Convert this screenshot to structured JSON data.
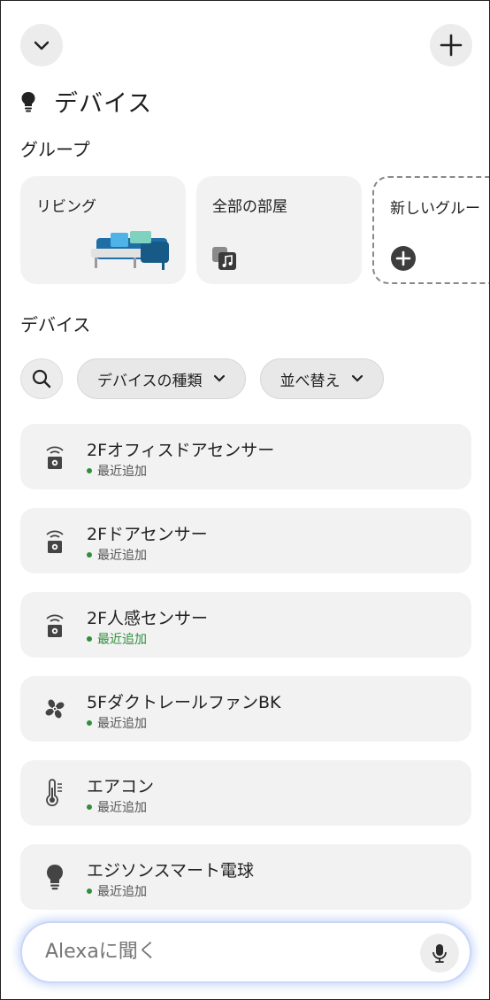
{
  "header": {
    "collapse_icon": "chevron-down-icon",
    "add_icon": "plus-icon",
    "title_icon": "lightbulb-icon",
    "title": "デバイス"
  },
  "groups": {
    "section_label": "グループ",
    "cards": [
      {
        "label": "リビング",
        "icon": "sofa-illustration"
      },
      {
        "label": "全部の部屋",
        "icon": "multi-device-music-icon"
      },
      {
        "label": "新しいグルー",
        "icon": "add-circle-icon"
      }
    ]
  },
  "devices": {
    "section_label": "デバイス",
    "filters": {
      "search_icon": "search-icon",
      "type_label": "デバイスの種類",
      "sort_label": "並べ替え"
    },
    "items": [
      {
        "name": "2Fオフィスドアセンサー",
        "status": "最近追加",
        "icon": "contact-sensor-icon"
      },
      {
        "name": "2Fドアセンサー",
        "status": "最近追加",
        "icon": "contact-sensor-icon"
      },
      {
        "name": "2F人感センサー",
        "status": "最近追加",
        "icon": "contact-sensor-icon"
      },
      {
        "name": "5FダクトレールファンBK",
        "status": "最近追加",
        "icon": "fan-icon"
      },
      {
        "name": "エアコン",
        "status": "最近追加",
        "icon": "thermometer-icon"
      },
      {
        "name": "エジソンスマート電球",
        "status": "最近追加",
        "icon": "lightbulb-icon"
      }
    ]
  },
  "ask_bar": {
    "placeholder": "Alexaに聞く",
    "mic_icon": "microphone-icon"
  },
  "colors": {
    "status_green": "#2f8f3a",
    "card_bg": "#f2f2f2",
    "accent_blue": "#1f6ea5"
  }
}
